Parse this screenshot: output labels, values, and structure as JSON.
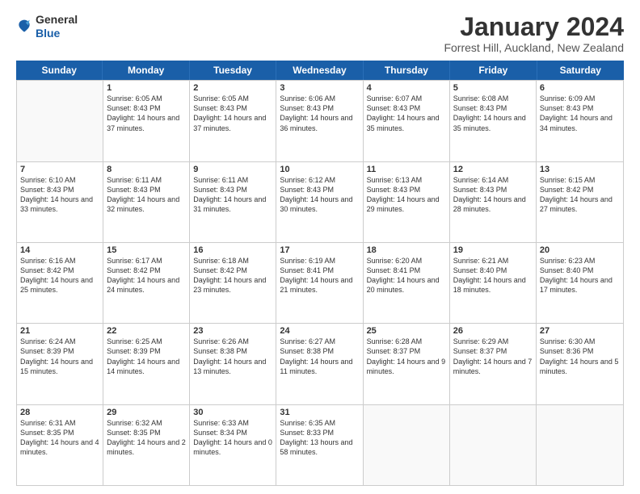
{
  "header": {
    "logo_general": "General",
    "logo_blue": "Blue",
    "title": "January 2024",
    "subtitle": "Forrest Hill, Auckland, New Zealand"
  },
  "days": [
    "Sunday",
    "Monday",
    "Tuesday",
    "Wednesday",
    "Thursday",
    "Friday",
    "Saturday"
  ],
  "weeks": [
    [
      {
        "day": "",
        "sunrise": "",
        "sunset": "",
        "daylight": ""
      },
      {
        "day": "1",
        "sunrise": "Sunrise: 6:05 AM",
        "sunset": "Sunset: 8:43 PM",
        "daylight": "Daylight: 14 hours and 37 minutes."
      },
      {
        "day": "2",
        "sunrise": "Sunrise: 6:05 AM",
        "sunset": "Sunset: 8:43 PM",
        "daylight": "Daylight: 14 hours and 37 minutes."
      },
      {
        "day": "3",
        "sunrise": "Sunrise: 6:06 AM",
        "sunset": "Sunset: 8:43 PM",
        "daylight": "Daylight: 14 hours and 36 minutes."
      },
      {
        "day": "4",
        "sunrise": "Sunrise: 6:07 AM",
        "sunset": "Sunset: 8:43 PM",
        "daylight": "Daylight: 14 hours and 35 minutes."
      },
      {
        "day": "5",
        "sunrise": "Sunrise: 6:08 AM",
        "sunset": "Sunset: 8:43 PM",
        "daylight": "Daylight: 14 hours and 35 minutes."
      },
      {
        "day": "6",
        "sunrise": "Sunrise: 6:09 AM",
        "sunset": "Sunset: 8:43 PM",
        "daylight": "Daylight: 14 hours and 34 minutes."
      }
    ],
    [
      {
        "day": "7",
        "sunrise": "Sunrise: 6:10 AM",
        "sunset": "Sunset: 8:43 PM",
        "daylight": "Daylight: 14 hours and 33 minutes."
      },
      {
        "day": "8",
        "sunrise": "Sunrise: 6:11 AM",
        "sunset": "Sunset: 8:43 PM",
        "daylight": "Daylight: 14 hours and 32 minutes."
      },
      {
        "day": "9",
        "sunrise": "Sunrise: 6:11 AM",
        "sunset": "Sunset: 8:43 PM",
        "daylight": "Daylight: 14 hours and 31 minutes."
      },
      {
        "day": "10",
        "sunrise": "Sunrise: 6:12 AM",
        "sunset": "Sunset: 8:43 PM",
        "daylight": "Daylight: 14 hours and 30 minutes."
      },
      {
        "day": "11",
        "sunrise": "Sunrise: 6:13 AM",
        "sunset": "Sunset: 8:43 PM",
        "daylight": "Daylight: 14 hours and 29 minutes."
      },
      {
        "day": "12",
        "sunrise": "Sunrise: 6:14 AM",
        "sunset": "Sunset: 8:43 PM",
        "daylight": "Daylight: 14 hours and 28 minutes."
      },
      {
        "day": "13",
        "sunrise": "Sunrise: 6:15 AM",
        "sunset": "Sunset: 8:42 PM",
        "daylight": "Daylight: 14 hours and 27 minutes."
      }
    ],
    [
      {
        "day": "14",
        "sunrise": "Sunrise: 6:16 AM",
        "sunset": "Sunset: 8:42 PM",
        "daylight": "Daylight: 14 hours and 25 minutes."
      },
      {
        "day": "15",
        "sunrise": "Sunrise: 6:17 AM",
        "sunset": "Sunset: 8:42 PM",
        "daylight": "Daylight: 14 hours and 24 minutes."
      },
      {
        "day": "16",
        "sunrise": "Sunrise: 6:18 AM",
        "sunset": "Sunset: 8:42 PM",
        "daylight": "Daylight: 14 hours and 23 minutes."
      },
      {
        "day": "17",
        "sunrise": "Sunrise: 6:19 AM",
        "sunset": "Sunset: 8:41 PM",
        "daylight": "Daylight: 14 hours and 21 minutes."
      },
      {
        "day": "18",
        "sunrise": "Sunrise: 6:20 AM",
        "sunset": "Sunset: 8:41 PM",
        "daylight": "Daylight: 14 hours and 20 minutes."
      },
      {
        "day": "19",
        "sunrise": "Sunrise: 6:21 AM",
        "sunset": "Sunset: 8:40 PM",
        "daylight": "Daylight: 14 hours and 18 minutes."
      },
      {
        "day": "20",
        "sunrise": "Sunrise: 6:23 AM",
        "sunset": "Sunset: 8:40 PM",
        "daylight": "Daylight: 14 hours and 17 minutes."
      }
    ],
    [
      {
        "day": "21",
        "sunrise": "Sunrise: 6:24 AM",
        "sunset": "Sunset: 8:39 PM",
        "daylight": "Daylight: 14 hours and 15 minutes."
      },
      {
        "day": "22",
        "sunrise": "Sunrise: 6:25 AM",
        "sunset": "Sunset: 8:39 PM",
        "daylight": "Daylight: 14 hours and 14 minutes."
      },
      {
        "day": "23",
        "sunrise": "Sunrise: 6:26 AM",
        "sunset": "Sunset: 8:38 PM",
        "daylight": "Daylight: 14 hours and 13 minutes."
      },
      {
        "day": "24",
        "sunrise": "Sunrise: 6:27 AM",
        "sunset": "Sunset: 8:38 PM",
        "daylight": "Daylight: 14 hours and 11 minutes."
      },
      {
        "day": "25",
        "sunrise": "Sunrise: 6:28 AM",
        "sunset": "Sunset: 8:37 PM",
        "daylight": "Daylight: 14 hours and 9 minutes."
      },
      {
        "day": "26",
        "sunrise": "Sunrise: 6:29 AM",
        "sunset": "Sunset: 8:37 PM",
        "daylight": "Daylight: 14 hours and 7 minutes."
      },
      {
        "day": "27",
        "sunrise": "Sunrise: 6:30 AM",
        "sunset": "Sunset: 8:36 PM",
        "daylight": "Daylight: 14 hours and 5 minutes."
      }
    ],
    [
      {
        "day": "28",
        "sunrise": "Sunrise: 6:31 AM",
        "sunset": "Sunset: 8:35 PM",
        "daylight": "Daylight: 14 hours and 4 minutes."
      },
      {
        "day": "29",
        "sunrise": "Sunrise: 6:32 AM",
        "sunset": "Sunset: 8:35 PM",
        "daylight": "Daylight: 14 hours and 2 minutes."
      },
      {
        "day": "30",
        "sunrise": "Sunrise: 6:33 AM",
        "sunset": "Sunset: 8:34 PM",
        "daylight": "Daylight: 14 hours and 0 minutes."
      },
      {
        "day": "31",
        "sunrise": "Sunrise: 6:35 AM",
        "sunset": "Sunset: 8:33 PM",
        "daylight": "Daylight: 13 hours and 58 minutes."
      },
      {
        "day": "",
        "sunrise": "",
        "sunset": "",
        "daylight": ""
      },
      {
        "day": "",
        "sunrise": "",
        "sunset": "",
        "daylight": ""
      },
      {
        "day": "",
        "sunrise": "",
        "sunset": "",
        "daylight": ""
      }
    ]
  ]
}
